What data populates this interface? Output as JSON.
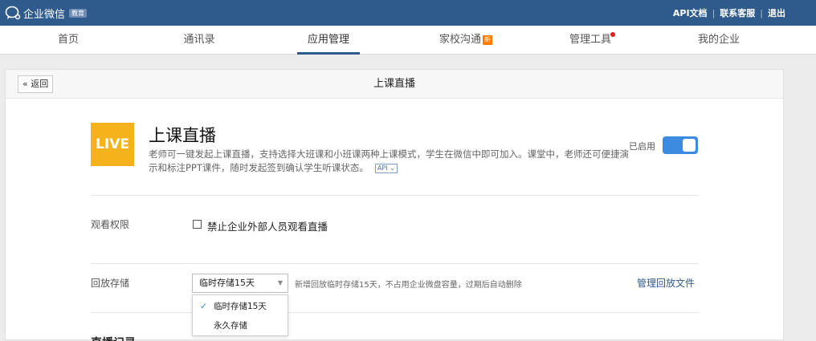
{
  "topbar": {
    "brand_name": "企业微信",
    "brand_badge": "教育",
    "links": [
      "API文档",
      "联系客服",
      "退出"
    ]
  },
  "nav": {
    "items": [
      "首页",
      "通讯录",
      "应用管理",
      "家校沟通",
      "管理工具",
      "我的企业"
    ],
    "active": "应用管理",
    "new_badge": "新"
  },
  "panel": {
    "back_label": "返回",
    "title": "上课直播"
  },
  "app": {
    "logo_text": "LIVE",
    "name": "上课直播",
    "description": "老师可一键发起上课直播，支持选择大班课和小班课两种上课模式，学生在微信中即可加入。课堂中，老师还可便捷演示和标注PPT课件，随时发起签到确认学生听课状态。",
    "api_tag": "API",
    "status_label": "已启用",
    "enabled": true
  },
  "settings": {
    "view_permission": {
      "label": "观看权限",
      "checkbox_label": "禁止企业外部人员观看直播",
      "checked": false
    },
    "playback_storage": {
      "label": "回放存储",
      "selected": "临时存储15天",
      "hint": "新增回放临时存储15天，不占用企业微盘容量，过期后自动删除",
      "manage_link": "管理回放文件",
      "options": [
        "临时存储15天",
        "永久存储"
      ]
    },
    "next_section_title": "直播记录"
  },
  "colors": {
    "topbar": "#2f5a8c",
    "toggle_on": "#3d8be0",
    "live_logo": "#f5b21b",
    "new_badge": "#ff7a00"
  }
}
